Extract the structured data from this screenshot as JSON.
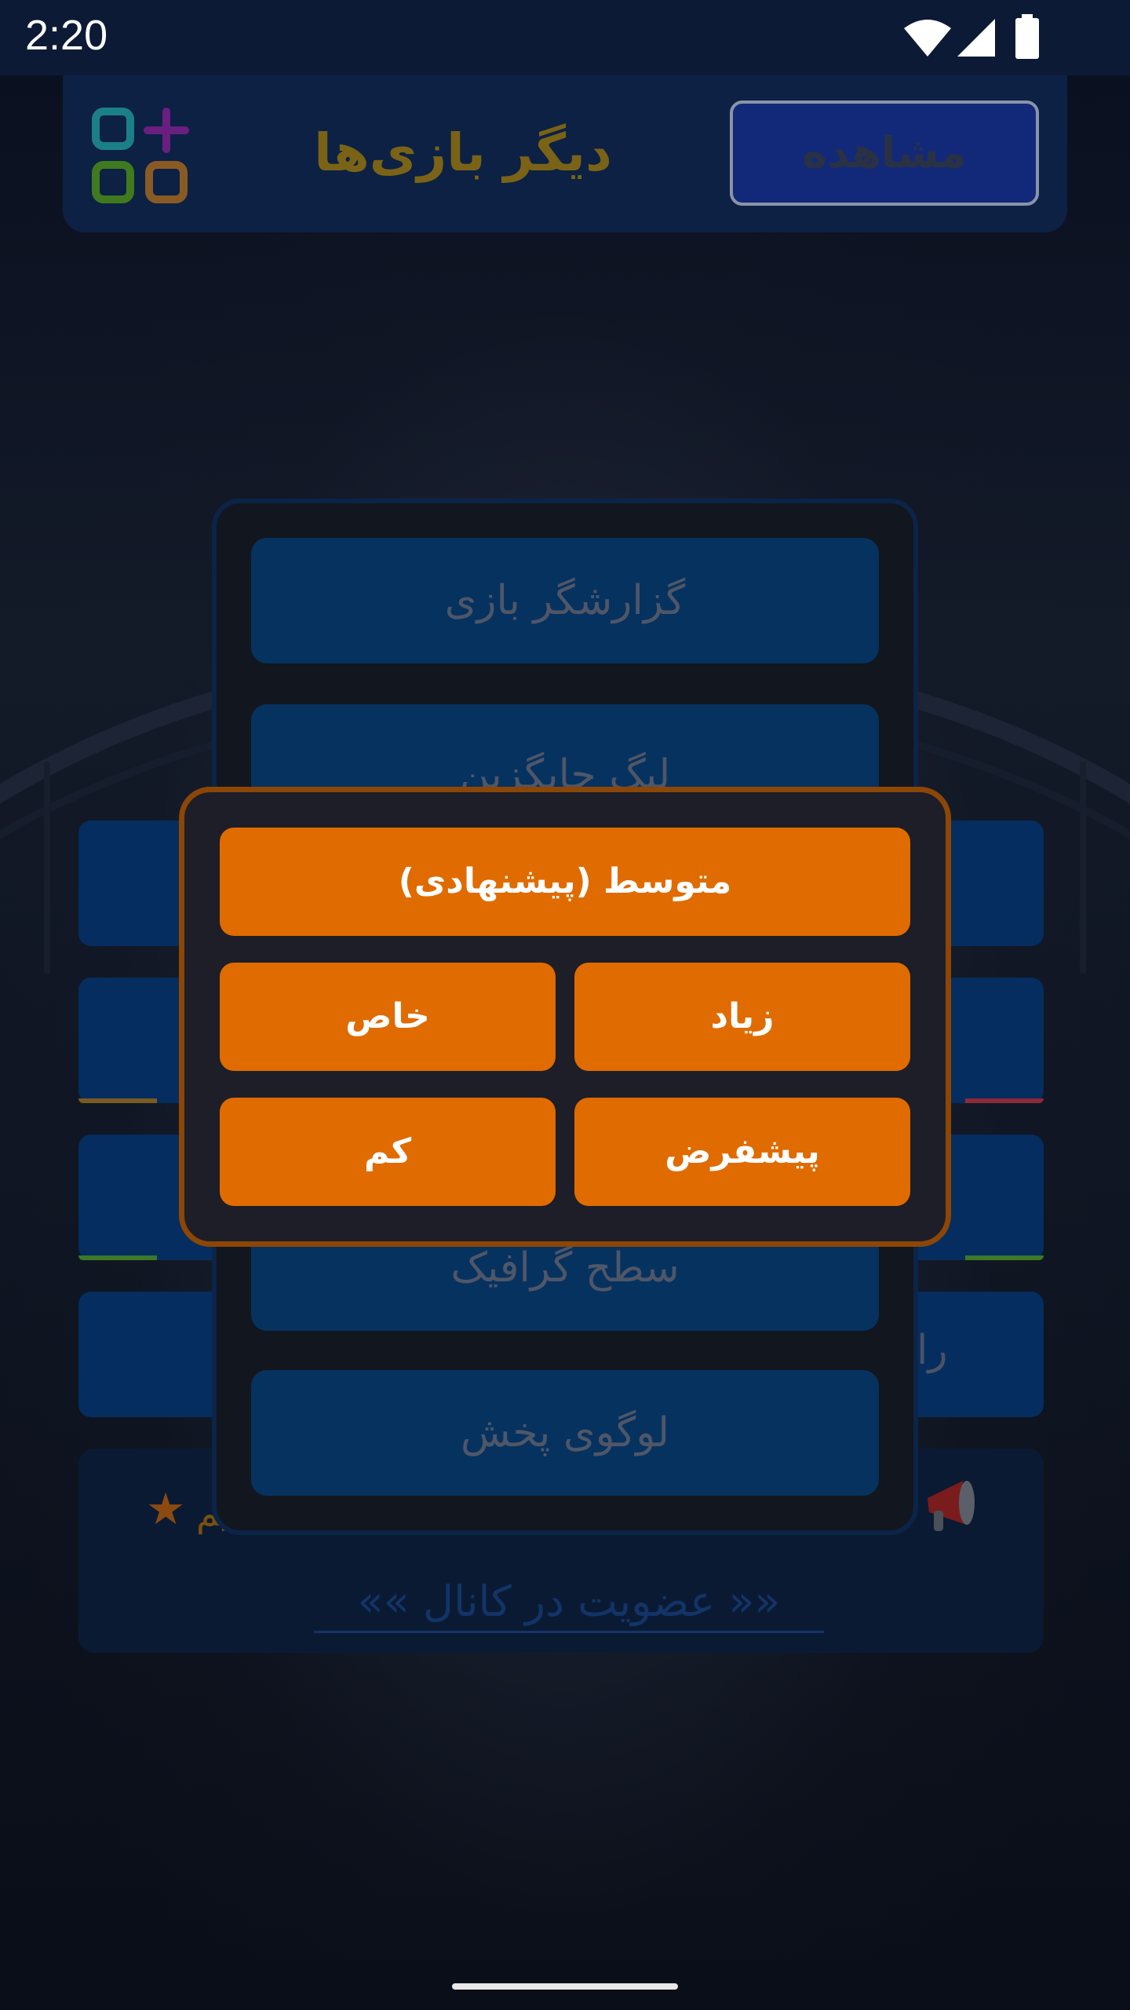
{
  "status_bar": {
    "time": "2:20"
  },
  "banner": {
    "title": "دیگر بازی‌ها",
    "view_button": "مشاهده"
  },
  "settings_panel": {
    "items": [
      {
        "label": "گزارشگر بازی"
      },
      {
        "label": "لیگ جایگزین"
      },
      {
        "label": "سطح گرافیک"
      },
      {
        "label": "لوگوی پخش"
      }
    ]
  },
  "background_row_fragment": "را",
  "channel": {
    "text_fragment": "یم",
    "link": "«« عضویت در کانال »»"
  },
  "dialog": {
    "options": {
      "medium": "متوسط (پیشنهادی)",
      "high": "زیاد",
      "custom": "خاص",
      "default": "پیشفرض",
      "low": "کم"
    }
  },
  "colors": {
    "accent_orange": "#e06b00",
    "dialog_border": "#8c4606",
    "panel_button": "#06325f"
  }
}
